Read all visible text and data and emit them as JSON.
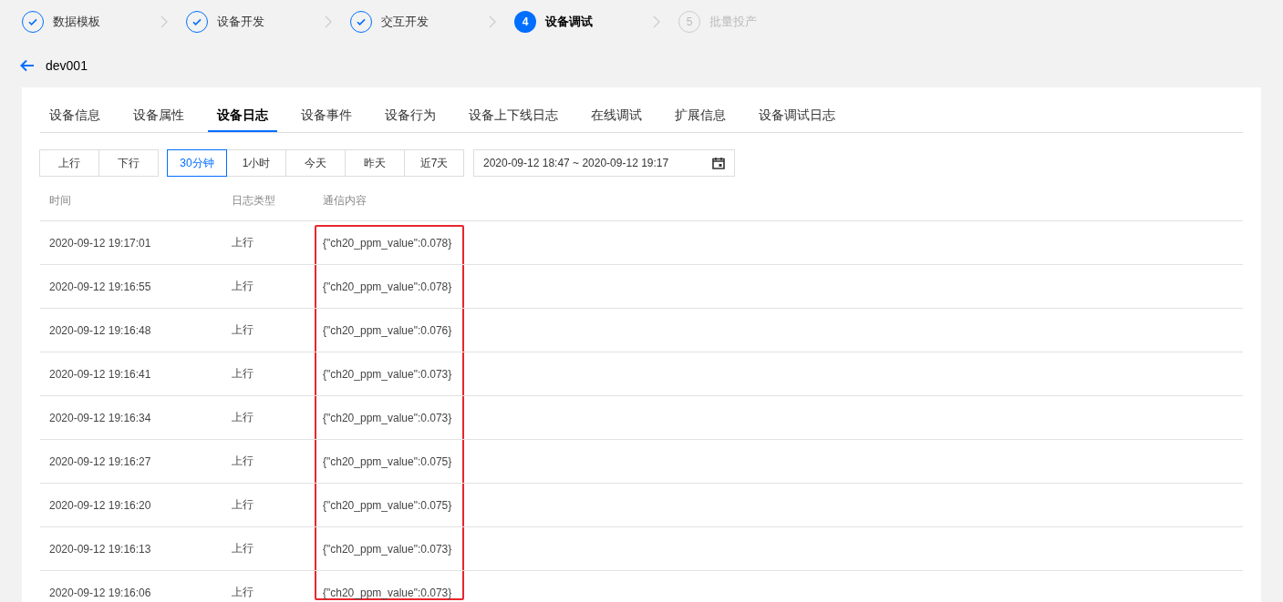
{
  "steps": [
    {
      "label": "数据模板",
      "kind": "done"
    },
    {
      "label": "设备开发",
      "kind": "done"
    },
    {
      "label": "交互开发",
      "kind": "done"
    },
    {
      "number": "4",
      "label": "设备调试",
      "kind": "current"
    },
    {
      "number": "5",
      "label": "批量投产",
      "kind": "pending"
    }
  ],
  "device": {
    "name": "dev001"
  },
  "tabs": [
    {
      "label": "设备信息",
      "selected": false
    },
    {
      "label": "设备属性",
      "selected": false
    },
    {
      "label": "设备日志",
      "selected": true
    },
    {
      "label": "设备事件",
      "selected": false
    },
    {
      "label": "设备行为",
      "selected": false
    },
    {
      "label": "设备上下线日志",
      "selected": false
    },
    {
      "label": "在线调试",
      "selected": false
    },
    {
      "label": "扩展信息",
      "selected": false
    },
    {
      "label": "设备调试日志",
      "selected": false
    }
  ],
  "direction_buttons": [
    {
      "label": "上行",
      "selected": false
    },
    {
      "label": "下行",
      "selected": false
    }
  ],
  "range_buttons": [
    {
      "label": "30分钟",
      "selected": true
    },
    {
      "label": "1小时",
      "selected": false
    },
    {
      "label": "今天",
      "selected": false
    },
    {
      "label": "昨天",
      "selected": false
    },
    {
      "label": "近7天",
      "selected": false
    }
  ],
  "date_range": {
    "value": "2020-09-12 18:47 ~ 2020-09-12 19:17"
  },
  "table": {
    "columns": [
      "时间",
      "日志类型",
      "通信内容"
    ],
    "rows": [
      [
        "2020-09-12 19:17:01",
        "上行",
        "{\"ch20_ppm_value\":0.078}"
      ],
      [
        "2020-09-12 19:16:55",
        "上行",
        "{\"ch20_ppm_value\":0.078}"
      ],
      [
        "2020-09-12 19:16:48",
        "上行",
        "{\"ch20_ppm_value\":0.076}"
      ],
      [
        "2020-09-12 19:16:41",
        "上行",
        "{\"ch20_ppm_value\":0.073}"
      ],
      [
        "2020-09-12 19:16:34",
        "上行",
        "{\"ch20_ppm_value\":0.073}"
      ],
      [
        "2020-09-12 19:16:27",
        "上行",
        "{\"ch20_ppm_value\":0.075}"
      ],
      [
        "2020-09-12 19:16:20",
        "上行",
        "{\"ch20_ppm_value\":0.075}"
      ],
      [
        "2020-09-12 19:16:13",
        "上行",
        "{\"ch20_ppm_value\":0.073}"
      ],
      [
        "2020-09-12 19:16:06",
        "上行",
        "{\"ch20_ppm_value\":0.073}"
      ]
    ]
  }
}
